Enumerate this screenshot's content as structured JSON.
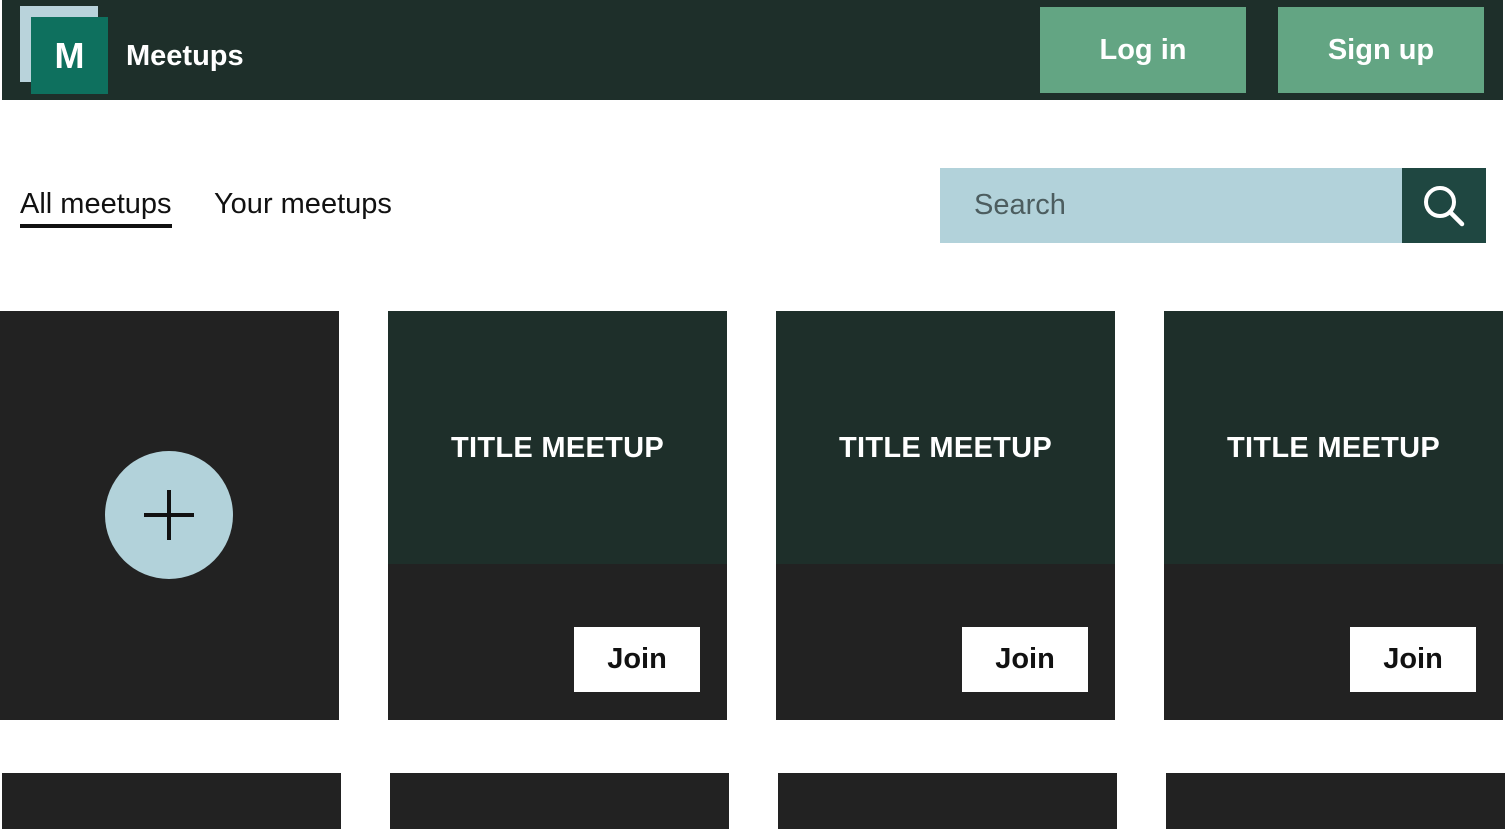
{
  "header": {
    "logo_letter": "M",
    "brand": "Meetups",
    "login_label": "Log in",
    "signup_label": "Sign up"
  },
  "tabs": [
    {
      "label": "All meetups",
      "active": true
    },
    {
      "label": "Your meetups",
      "active": false
    }
  ],
  "search": {
    "placeholder": "Search",
    "icon": "search-icon"
  },
  "add_card": {
    "icon": "plus-icon"
  },
  "meetups": [
    {
      "title": "TITLE MEETUP",
      "join_label": "Join"
    },
    {
      "title": "TITLE MEETUP",
      "join_label": "Join"
    },
    {
      "title": "TITLE MEETUP",
      "join_label": "Join"
    }
  ],
  "colors": {
    "header_bg": "#1e2f2a",
    "header_button": "#63a583",
    "logo": "#0e705e",
    "search_bg": "#b2d2da",
    "search_button": "#1f4741",
    "card_bg": "#222222"
  }
}
